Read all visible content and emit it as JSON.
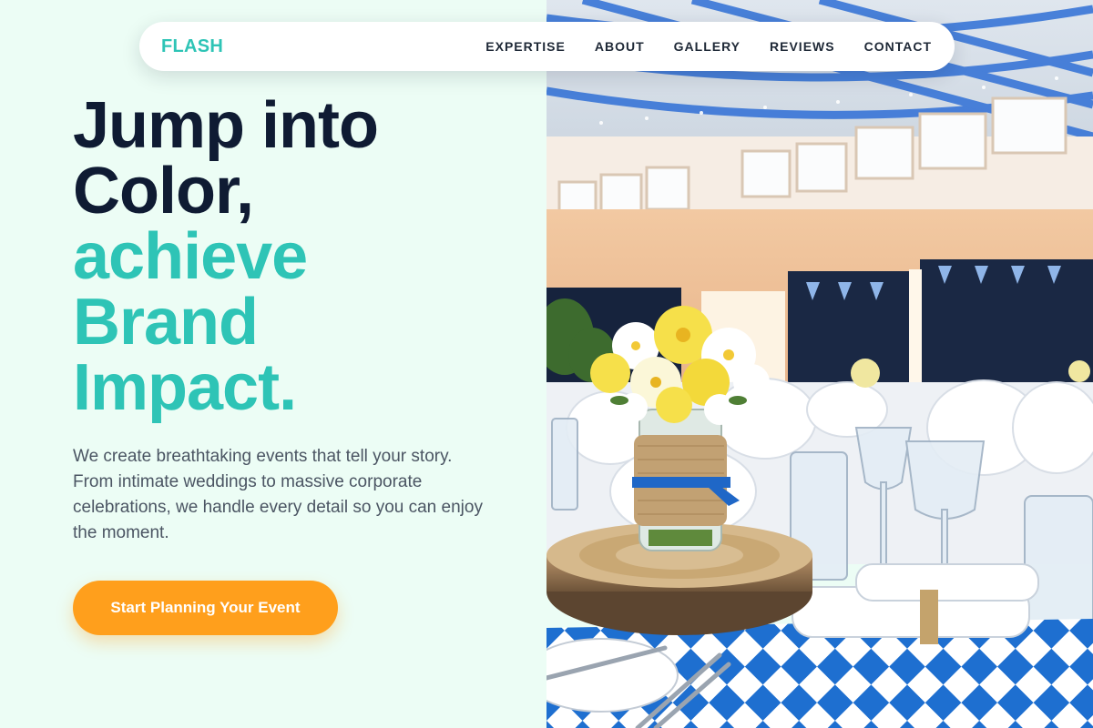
{
  "nav": {
    "logo": "FLASH",
    "links": [
      "EXPERTISE",
      "ABOUT",
      "GALLERY",
      "REVIEWS",
      "CONTACT"
    ]
  },
  "hero": {
    "headline_dark": [
      "Jump into",
      "Color,"
    ],
    "headline_accent": [
      "achieve",
      "Brand",
      "Impact."
    ],
    "description": "We create breathtaking events that tell your story. From intimate weddings to massive corporate celebrations, we handle every detail so you can enjoy the moment.",
    "cta_label": "Start Planning Your Event"
  },
  "colors": {
    "background": "#ecfdf5",
    "accent_teal": "#2ec4b6",
    "heading_navy": "#0f1b33",
    "cta_orange": "#ff9f1c"
  },
  "photo": {
    "subject": "event hall with decorated banquet tables and flower centerpiece"
  }
}
